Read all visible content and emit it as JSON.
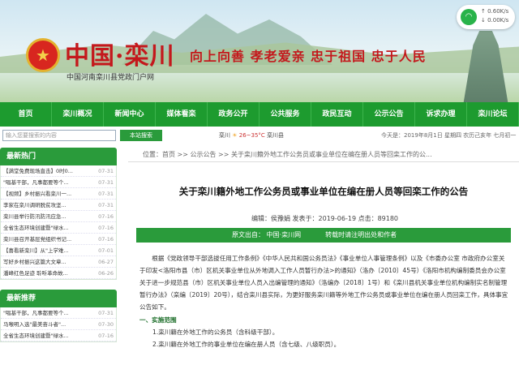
{
  "banner": {
    "site_title": "中国·栾川",
    "site_sub": "中国河南栾川县党政门户网",
    "slogan": "向上向善  孝老爱亲  忠于祖国  忠于人民",
    "speed_up": "0.60K/s",
    "speed_down": "0.00K/s"
  },
  "nav": [
    "首页",
    "栾川概况",
    "新闻中心",
    "媒体看栾",
    "政务公开",
    "公共服务",
    "政民互动",
    "公示公告",
    "诉求办理",
    "栾川论坛"
  ],
  "toolbar": {
    "search_placeholder": "输入您要搜索的内容",
    "search_button": "本站搜索",
    "weather_city": "栾川",
    "weather_temp": "26~35°C",
    "weather_suffix": "栾川县",
    "date": "今天是：2019年8月1日 星期四 农历己亥年 七月初一"
  },
  "sidebar": {
    "latest_title": "最新热门",
    "latest": [
      {
        "t": "【满堂免费现场直击】0时0...",
        "d": "07-31"
      },
      {
        "t": "\"唱基干部，凡事都要等个...",
        "d": "07-31"
      },
      {
        "t": "【视频】乡村振兴看栾川一...",
        "d": "07-31"
      },
      {
        "t": "李家在栾川调研脱贫攻坚...",
        "d": "07-31"
      },
      {
        "t": "栾川县举行防汛防汛应急...",
        "d": "07-16"
      },
      {
        "t": "全省生态环境创建暨\"绿水...",
        "d": "07-16"
      },
      {
        "t": "栾川县召开基层党组织书记...",
        "d": "07-16"
      },
      {
        "t": "【喜看新栾川】从\"上学难...",
        "d": "07-01"
      },
      {
        "t": "写好乡村振兴这篇大文章...",
        "d": "06-27"
      },
      {
        "t": "潘峰红色足迹  聆听革命故...",
        "d": "06-26"
      }
    ],
    "recommend_title": "最新推荐",
    "recommend": [
      {
        "t": "\"唱基干部，凡事都要等个...",
        "d": "07-31"
      },
      {
        "t": "马喉明入选\"最美奋斗者\"...",
        "d": "07-30"
      },
      {
        "t": "全省生态环境创建暨\"绿水...",
        "d": "07-16"
      }
    ]
  },
  "main": {
    "crumb_prefix": "位置：",
    "crumb_home": "首页",
    "crumb_sep": " >> ",
    "crumb_section": "公示公告",
    "crumb_current": "关于栾川籍外地工作公务员或事业单位在编在册人员等回栾工作的公...",
    "title": "关于栾川籍外地工作公务员或事业单位在编在册人员等回栾工作的公告",
    "meta": "编辑：侯豫娟  发表于：2019-06-19  点击：89180",
    "source": "原文出自：  中国·栾川网",
    "source_note": "转载时请注明出处和作者",
    "para1": "根据《党政领导干部选拔任用工作条例》《中华人民共和国公务员法》《事业单位人事管理条例》以及《市委办公室  市政府办公室关于印发<洛阳市县（市）区机关事业单位从外地调入工作人员暂行办法>的通知》（洛办〔2010〕45号）《洛阳市机构编制委员会办公室关于进一步规范县（市）区机关事业单位人员入出编管理的通知》（洛编办〔2018〕1号）和《栾川县机关事业单位机构编制实名制管理暂行办法》（栾编〔2019〕20号），结合栾川县实际，为更好服务栾川籍等外地工作公务员或事业单位在编在册人员回栾工作，具体事宜公告如下。",
    "h1": "一、实施范围",
    "li1": "1.栾川籍在外地工作的公务员（含科级干部）。",
    "li2": "2.栾川籍在外地工作的事业单位在编在册人员（含七级、八级职员）。"
  }
}
